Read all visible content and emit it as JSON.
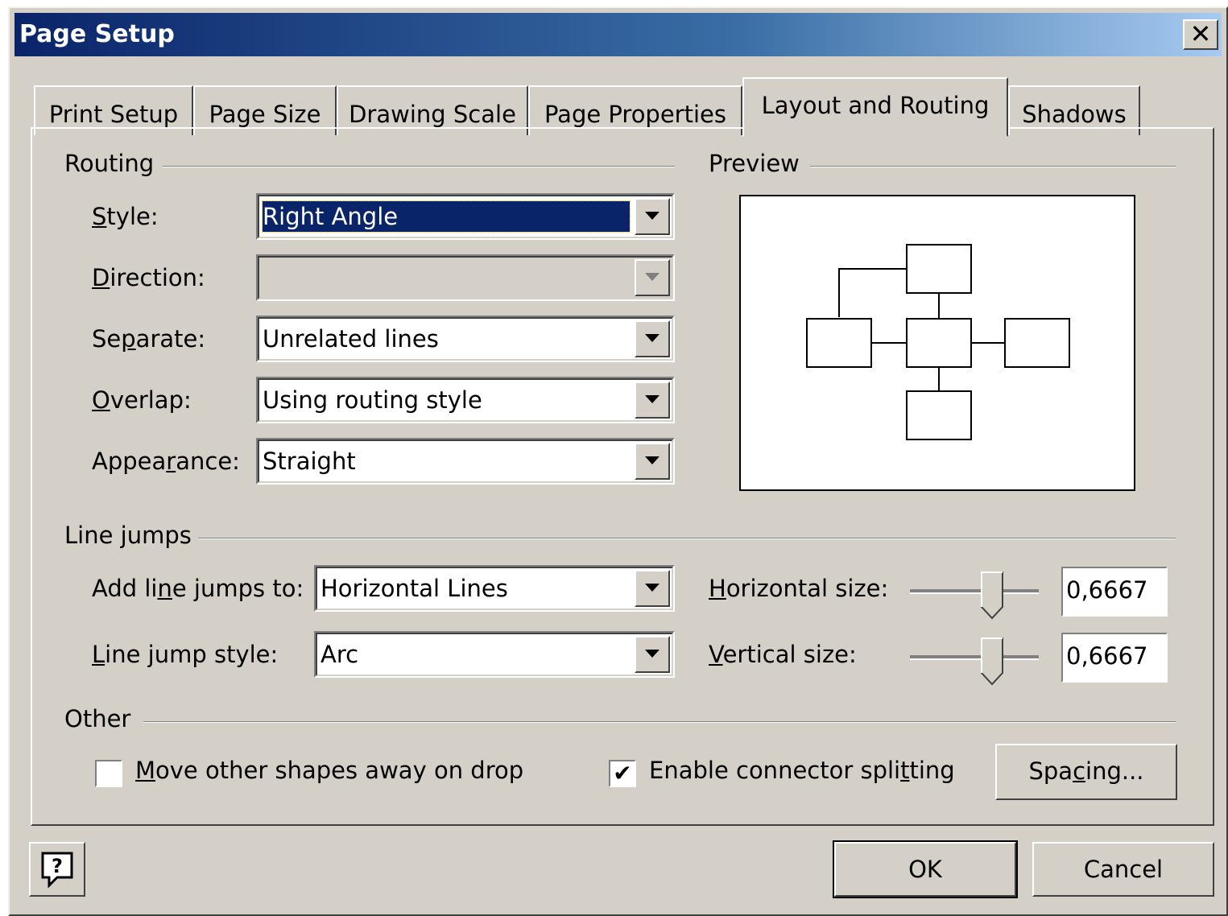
{
  "window": {
    "title": "Page Setup",
    "close_icon": "close-icon"
  },
  "tabs": [
    {
      "label": "Print Setup",
      "active": false
    },
    {
      "label": "Page Size",
      "active": false
    },
    {
      "label": "Drawing Scale",
      "active": false
    },
    {
      "label": "Page Properties",
      "active": false
    },
    {
      "label": "Layout and Routing",
      "active": true
    },
    {
      "label": "Shadows",
      "active": false
    }
  ],
  "routing": {
    "group_label": "Routing",
    "style": {
      "label": "Style:",
      "value": "Right Angle"
    },
    "direction": {
      "label": "Direction:",
      "value": ""
    },
    "separate": {
      "label": "Separate:",
      "value": "Unrelated lines"
    },
    "overlap": {
      "label": "Overlap:",
      "value": "Using routing style"
    },
    "appearance": {
      "label": "Appearance:",
      "value": "Straight"
    }
  },
  "preview": {
    "group_label": "Preview"
  },
  "line_jumps": {
    "group_label": "Line jumps",
    "add_to": {
      "label": "Add line jumps to:",
      "value": "Horizontal Lines"
    },
    "style": {
      "label": "Line jump style:",
      "value": "Arc"
    },
    "horizontal_size": {
      "label": "Horizontal size:",
      "value": "0,6667"
    },
    "vertical_size": {
      "label": "Vertical size:",
      "value": "0,6667"
    }
  },
  "other": {
    "group_label": "Other",
    "move_shapes": {
      "label": "Move other shapes away on drop",
      "checked": false
    },
    "connector_splitting": {
      "label": "Enable connector splitting",
      "checked": true
    },
    "spacing_button": "Spacing..."
  },
  "footer": {
    "help_icon": "help-icon",
    "ok": "OK",
    "cancel": "Cancel"
  }
}
